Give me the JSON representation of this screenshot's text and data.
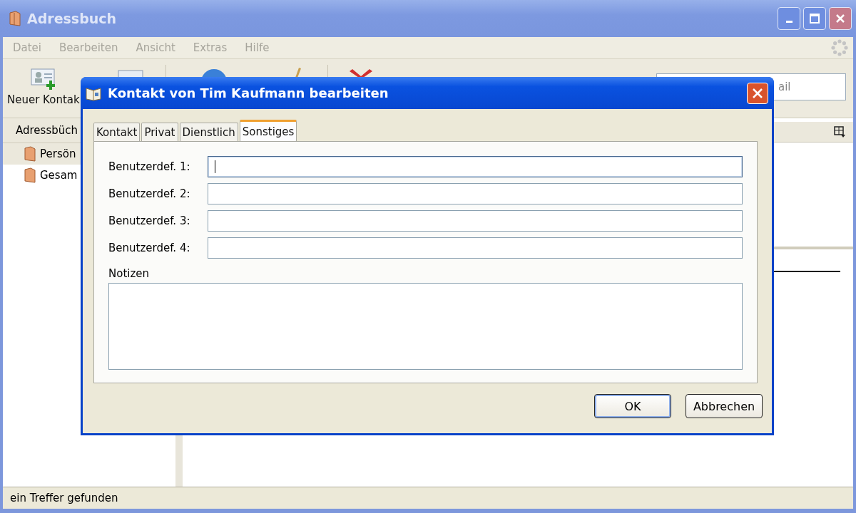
{
  "window": {
    "title": "Adressbuch"
  },
  "menu": [
    "Datei",
    "Bearbeiten",
    "Ansicht",
    "Extras",
    "Hilfe"
  ],
  "toolbar": {
    "new_contact": "Neuer Kontak"
  },
  "search": {
    "placeholder": "ail"
  },
  "sidebar": {
    "header": "Adressbüch",
    "items": [
      {
        "label": "Persön",
        "selected": true
      },
      {
        "label": "Gesam",
        "selected": false
      }
    ]
  },
  "status_bar": "ein Treffer gefunden",
  "dialog": {
    "title": "Kontakt von Tim Kaufmann bearbeiten",
    "tabs": [
      {
        "label": "Kontakt",
        "selected": false
      },
      {
        "label": "Privat",
        "selected": false
      },
      {
        "label": "Dienstlich",
        "selected": false
      },
      {
        "label": "Sonstiges",
        "selected": true
      }
    ],
    "fields": [
      {
        "label": "Benutzerdef. 1:",
        "focused": true
      },
      {
        "label": "Benutzerdef. 2:",
        "focused": false
      },
      {
        "label": "Benutzerdef. 3:",
        "focused": false
      },
      {
        "label": "Benutzerdef. 4:",
        "focused": false
      }
    ],
    "notes_label": "Notizen",
    "buttons": [
      {
        "label": "OK",
        "default": true
      },
      {
        "label": "Abbrechen",
        "default": false
      }
    ]
  }
}
